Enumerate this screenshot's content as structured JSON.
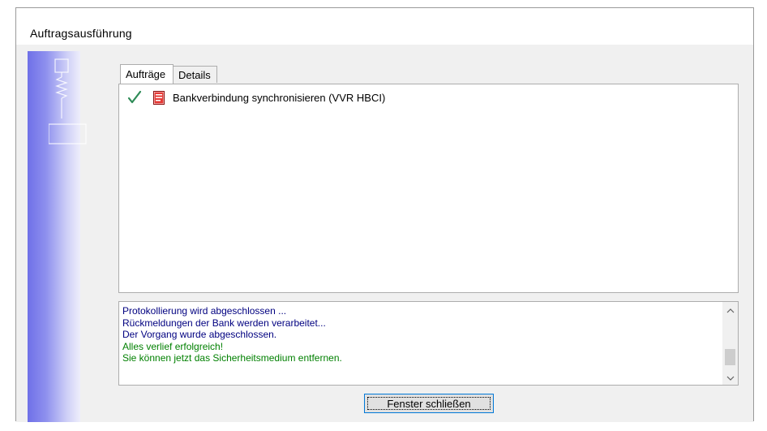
{
  "window": {
    "title": "Auftragsausführung"
  },
  "tabs": [
    {
      "label": "Aufträge",
      "active": true
    },
    {
      "label": "Details",
      "active": false
    }
  ],
  "tasks": [
    {
      "status_icon": "check-icon",
      "type_icon": "document-icon",
      "label": "Bankverbindung synchronisieren (VVR HBCI)"
    }
  ],
  "log": {
    "lines": [
      {
        "text": "Protokollierung wird abgeschlossen ...",
        "kind": "info"
      },
      {
        "text": "Rückmeldungen der Bank werden verarbeitet...",
        "kind": "info"
      },
      {
        "text": "Der Vorgang wurde abgeschlossen.",
        "kind": "info"
      },
      {
        "text": "Alles verlief erfolgreich!",
        "kind": "success"
      },
      {
        "text": "Sie können jetzt das Sicherheitsmedium entfernen.",
        "kind": "success"
      }
    ]
  },
  "buttons": {
    "close_label": "Fenster schließen"
  },
  "colors": {
    "info_text": "#000080",
    "success_text": "#008000",
    "check_mark": "#2e8b57",
    "banner_blue": "#6f70e8",
    "focus_border": "#0078d7"
  }
}
